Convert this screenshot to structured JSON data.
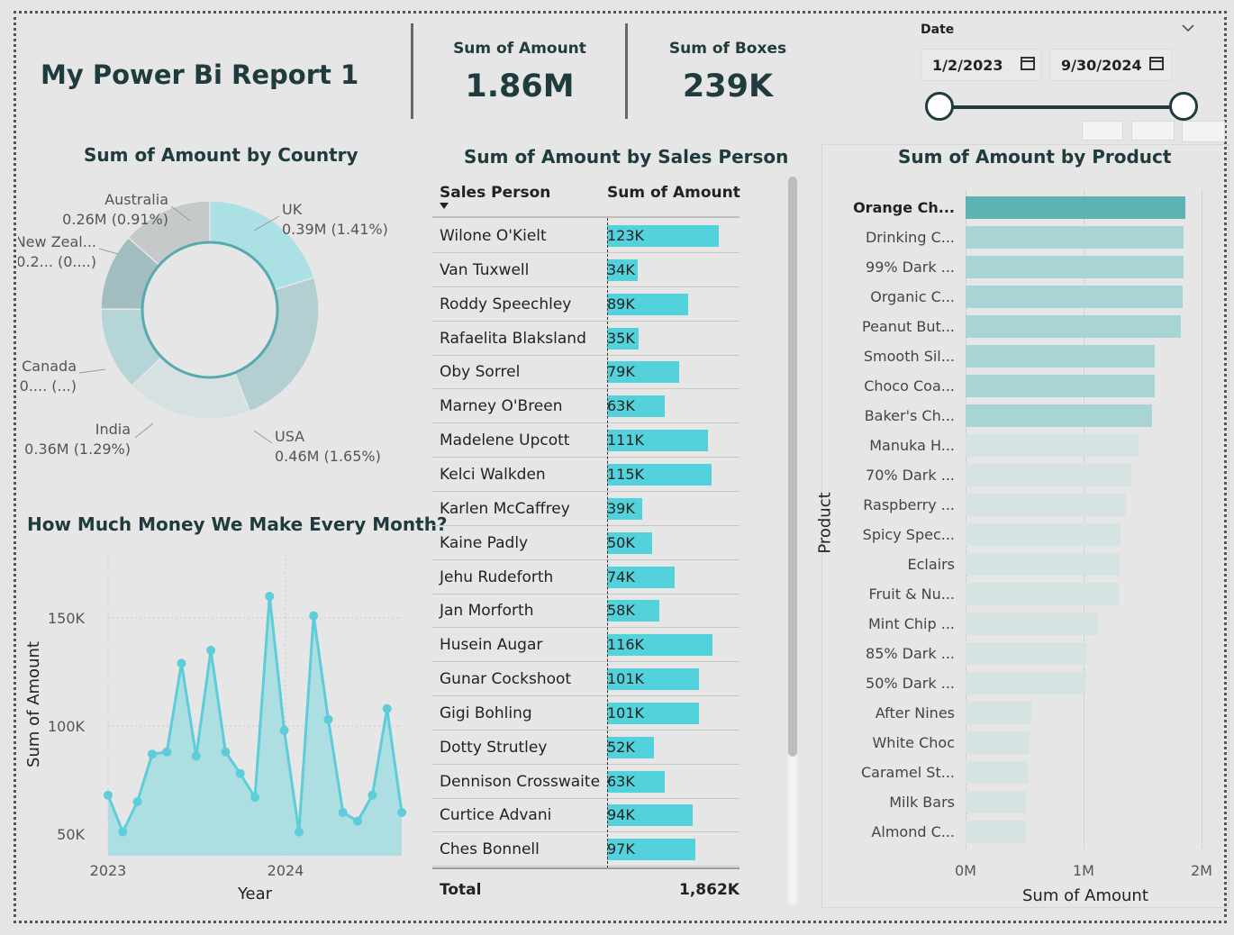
{
  "report": {
    "title": "My Power Bi Report 1"
  },
  "cards": [
    {
      "label": "Sum of Amount",
      "value": "1.86M"
    },
    {
      "label": "Sum of Boxes",
      "value": "239K"
    }
  ],
  "date_slicer": {
    "label": "Date",
    "start": "1/2/2023",
    "end": "9/30/2024"
  },
  "donut": {
    "title": "Sum of Amount by Country",
    "slices": [
      {
        "name": "UK",
        "detail": "0.39M (1.41%)",
        "value": 0.39,
        "color": "#abe0e4"
      },
      {
        "name": "USA",
        "detail": "0.46M (1.65%)",
        "value": 0.46,
        "color": "#b3cfd1"
      },
      {
        "name": "India",
        "detail": "0.36M (1.29%)",
        "value": 0.36,
        "color": "#d7e1e1"
      },
      {
        "name": "Canada",
        "detail": "0.... (...)",
        "value": 0.24,
        "color": "#b5d5d8"
      },
      {
        "name": "New Zeal...",
        "detail": "0.2... (0....)",
        "value": 0.22,
        "color": "#a2bdbf"
      },
      {
        "name": "Australia",
        "detail": "0.26M (0.91%)",
        "value": 0.26,
        "color": "#c6c9c9"
      }
    ]
  },
  "line_chart": {
    "title": "How Much Money We Make Every Month?",
    "xlabel": "Year",
    "ylabel": "Sum of Amount",
    "x_ticks": [
      "2023",
      "2024"
    ],
    "y_ticks": [
      "150K",
      "100K",
      "50K"
    ]
  },
  "sales_table": {
    "title": "Sum of Amount by Sales Person",
    "col1": "Sales Person",
    "col2": "Sum of Amount",
    "rows": [
      {
        "name": "Wilone O'Kielt",
        "label": "123K",
        "value": 123
      },
      {
        "name": "Van Tuxwell",
        "label": "34K",
        "value": 34
      },
      {
        "name": "Roddy Speechley",
        "label": "89K",
        "value": 89
      },
      {
        "name": "Rafaelita Blaksland",
        "label": "35K",
        "value": 35
      },
      {
        "name": "Oby Sorrel",
        "label": "79K",
        "value": 79
      },
      {
        "name": "Marney O'Breen",
        "label": "63K",
        "value": 63
      },
      {
        "name": "Madelene Upcott",
        "label": "111K",
        "value": 111
      },
      {
        "name": "Kelci Walkden",
        "label": "115K",
        "value": 115
      },
      {
        "name": "Karlen McCaffrey",
        "label": "39K",
        "value": 39
      },
      {
        "name": "Kaine Padly",
        "label": "50K",
        "value": 50
      },
      {
        "name": "Jehu Rudeforth",
        "label": "74K",
        "value": 74
      },
      {
        "name": "Jan Morforth",
        "label": "58K",
        "value": 58
      },
      {
        "name": "Husein Augar",
        "label": "116K",
        "value": 116
      },
      {
        "name": "Gunar Cockshoot",
        "label": "101K",
        "value": 101
      },
      {
        "name": "Gigi Bohling",
        "label": "101K",
        "value": 101
      },
      {
        "name": "Dotty Strutley",
        "label": "52K",
        "value": 52
      },
      {
        "name": "Dennison Crosswaite",
        "label": "63K",
        "value": 63
      },
      {
        "name": "Curtice Advani",
        "label": "94K",
        "value": 94
      },
      {
        "name": "Ches Bonnell",
        "label": "97K",
        "value": 97
      }
    ],
    "total_label": "Total",
    "total_value": "1,862K"
  },
  "product_chart": {
    "title": "Sum of Amount by Product",
    "ylabel": "Product",
    "xlabel": "Sum of Amount",
    "x_ticks": [
      "0M",
      "1M",
      "2M"
    ]
  },
  "chart_data": [
    {
      "type": "area",
      "title": "How Much Money We Make Every Month?",
      "xlabel": "Year",
      "ylabel": "Sum of Amount",
      "x": [
        "2023-01",
        "2023-02",
        "2023-03",
        "2023-04",
        "2023-05",
        "2023-06",
        "2023-07",
        "2023-08",
        "2023-09",
        "2023-10",
        "2023-11",
        "2023-12",
        "2024-01",
        "2024-02",
        "2024-03",
        "2024-04",
        "2024-05",
        "2024-06",
        "2024-07",
        "2024-08",
        "2024-09"
      ],
      "values": [
        68000,
        51000,
        65000,
        87000,
        88000,
        129000,
        86000,
        135000,
        88000,
        78000,
        67000,
        160000,
        98000,
        51000,
        151000,
        103000,
        60000,
        56000,
        68000,
        108000,
        60000
      ],
      "ylim": [
        40000,
        170000
      ],
      "grid": true,
      "color": "#5ccdd9"
    },
    {
      "type": "bar",
      "orientation": "horizontal",
      "title": "Sum of Amount by Product",
      "xlabel": "Sum of Amount",
      "ylabel": "Product",
      "xlim": [
        0,
        2000000
      ],
      "categories": [
        "Orange Ch...",
        "Drinking C...",
        "99% Dark ...",
        "Organic C...",
        "Peanut But...",
        "Smooth Sil...",
        "Choco Coa...",
        "Baker's Ch...",
        "Manuka H...",
        "70% Dark ...",
        "Raspberry ...",
        "Spicy Spec...",
        "Eclairs",
        "Fruit & Nu...",
        "Mint Chip ...",
        "85% Dark ...",
        "50% Dark ...",
        "After Nines",
        "White Choc",
        "Caramel St...",
        "Milk Bars",
        "Almond C..."
      ],
      "values": [
        1860000,
        1850000,
        1845000,
        1840000,
        1825000,
        1605000,
        1600000,
        1580000,
        1465000,
        1405000,
        1360000,
        1315000,
        1305000,
        1295000,
        1120000,
        1030000,
        1025000,
        560000,
        545000,
        535000,
        515000,
        510000
      ],
      "colors": {
        "top": "#5fb2b3",
        "mid": "#a9d4d6",
        "low": "#d6e3e3"
      }
    }
  ]
}
